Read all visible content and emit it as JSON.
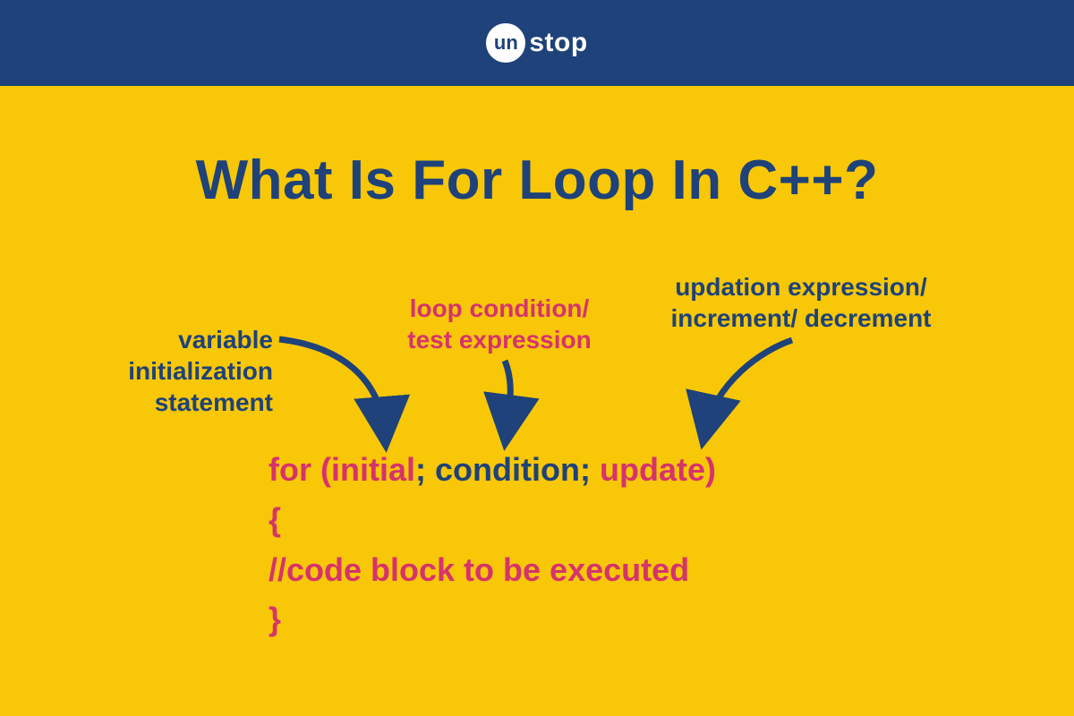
{
  "header": {
    "logo_circle_text": "un",
    "logo_text": "stop"
  },
  "title": "What Is For Loop In C++?",
  "labels": {
    "init_line1": "variable",
    "init_line2": "initialization",
    "init_line3": "statement",
    "cond_line1": "loop condition/",
    "cond_line2": "test expression",
    "upd_line1": "updation expression/",
    "upd_line2": "increment/ decrement"
  },
  "code": {
    "for_kw": "for (",
    "initial": "initial",
    "sep1": "; ",
    "condition": "condition",
    "sep2": "; ",
    "update": "update",
    "close_paren": ")",
    "open_brace": "{",
    "comment": "//code block to be executed",
    "close_brace": "}"
  },
  "colors": {
    "navy": "#1e4279",
    "yellow": "#f7c708",
    "pink": "#d6336c",
    "white": "#ffffff"
  }
}
